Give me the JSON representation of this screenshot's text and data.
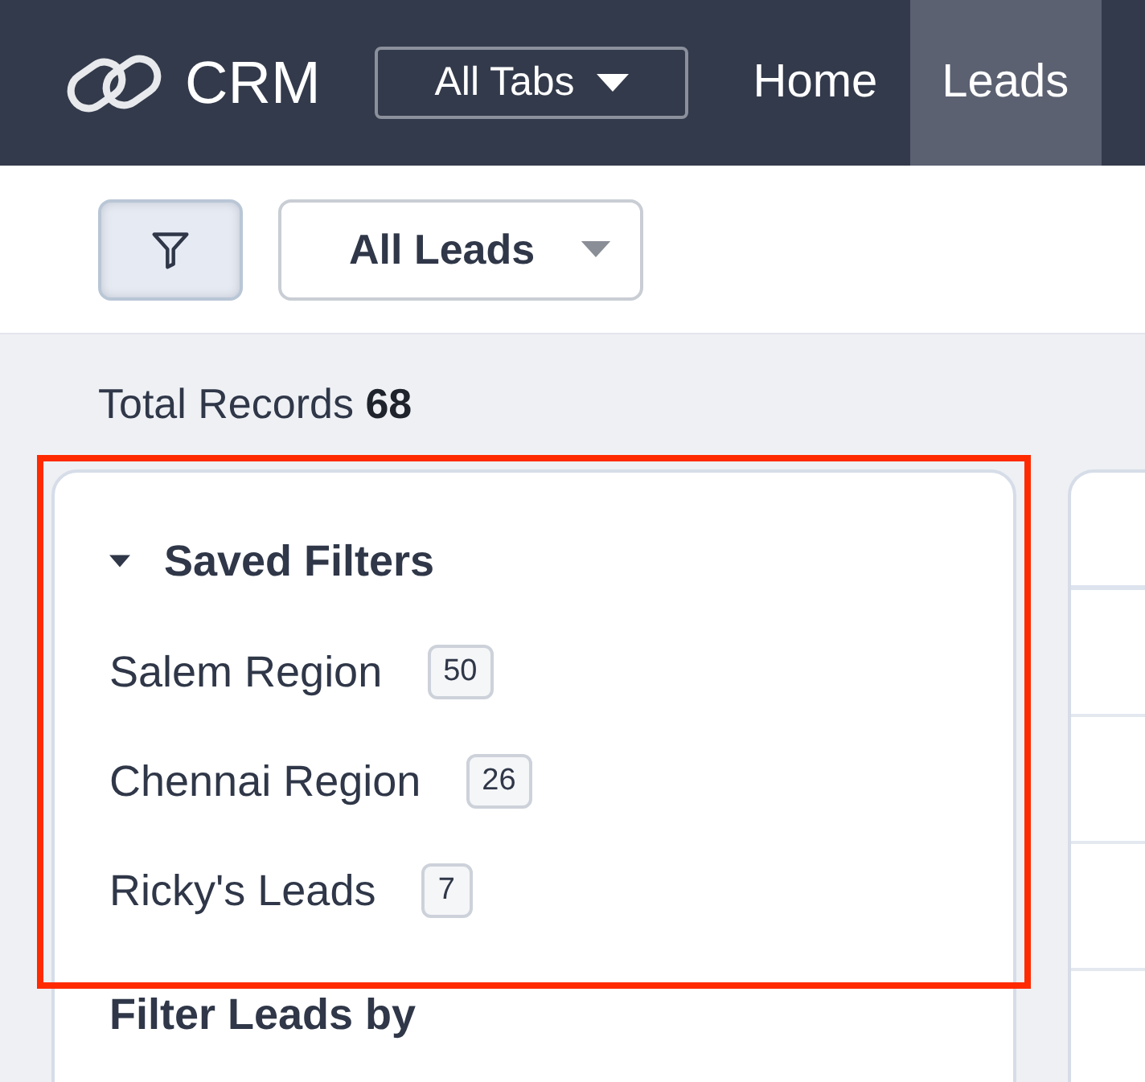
{
  "nav": {
    "logo": "CRM",
    "tabs_menu": {
      "label": "All Tabs"
    },
    "tabs": [
      {
        "label": "Home",
        "selected": false
      },
      {
        "label": "Leads",
        "selected": true
      }
    ]
  },
  "toolbar": {
    "filter_button": {
      "active": true
    },
    "view_select": {
      "value": "All Leads"
    }
  },
  "summary": {
    "label": "Total Records",
    "count": "68"
  },
  "saved_filters": {
    "title": "Saved Filters",
    "expanded": true,
    "highlighted": true,
    "items": [
      {
        "name": "Salem Region",
        "count": "50"
      },
      {
        "name": "Chennai Region",
        "count": "26"
      },
      {
        "name": "Ricky's Leads",
        "count": "7"
      }
    ]
  },
  "filter_by": {
    "title": "Filter Leads by"
  }
}
